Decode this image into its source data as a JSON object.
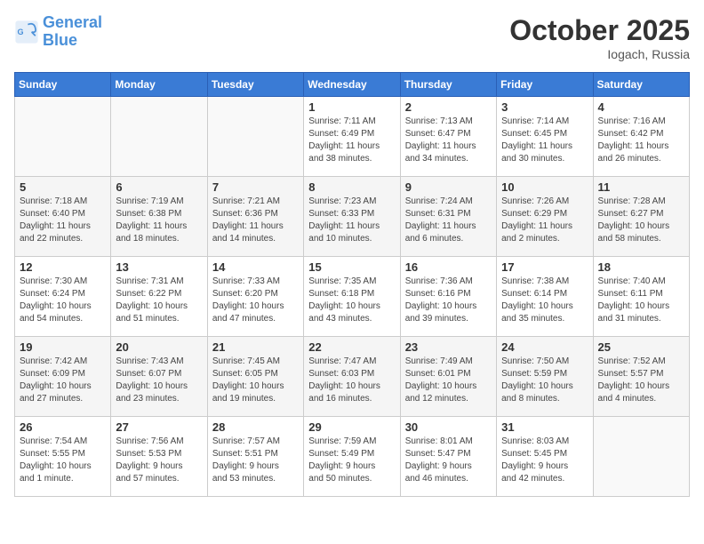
{
  "header": {
    "logo_line1": "General",
    "logo_line2": "Blue",
    "month": "October 2025",
    "location": "Iogach, Russia"
  },
  "days_of_week": [
    "Sunday",
    "Monday",
    "Tuesday",
    "Wednesday",
    "Thursday",
    "Friday",
    "Saturday"
  ],
  "weeks": [
    [
      {
        "day": "",
        "info": ""
      },
      {
        "day": "",
        "info": ""
      },
      {
        "day": "",
        "info": ""
      },
      {
        "day": "1",
        "info": "Sunrise: 7:11 AM\nSunset: 6:49 PM\nDaylight: 11 hours\nand 38 minutes."
      },
      {
        "day": "2",
        "info": "Sunrise: 7:13 AM\nSunset: 6:47 PM\nDaylight: 11 hours\nand 34 minutes."
      },
      {
        "day": "3",
        "info": "Sunrise: 7:14 AM\nSunset: 6:45 PM\nDaylight: 11 hours\nand 30 minutes."
      },
      {
        "day": "4",
        "info": "Sunrise: 7:16 AM\nSunset: 6:42 PM\nDaylight: 11 hours\nand 26 minutes."
      }
    ],
    [
      {
        "day": "5",
        "info": "Sunrise: 7:18 AM\nSunset: 6:40 PM\nDaylight: 11 hours\nand 22 minutes."
      },
      {
        "day": "6",
        "info": "Sunrise: 7:19 AM\nSunset: 6:38 PM\nDaylight: 11 hours\nand 18 minutes."
      },
      {
        "day": "7",
        "info": "Sunrise: 7:21 AM\nSunset: 6:36 PM\nDaylight: 11 hours\nand 14 minutes."
      },
      {
        "day": "8",
        "info": "Sunrise: 7:23 AM\nSunset: 6:33 PM\nDaylight: 11 hours\nand 10 minutes."
      },
      {
        "day": "9",
        "info": "Sunrise: 7:24 AM\nSunset: 6:31 PM\nDaylight: 11 hours\nand 6 minutes."
      },
      {
        "day": "10",
        "info": "Sunrise: 7:26 AM\nSunset: 6:29 PM\nDaylight: 11 hours\nand 2 minutes."
      },
      {
        "day": "11",
        "info": "Sunrise: 7:28 AM\nSunset: 6:27 PM\nDaylight: 10 hours\nand 58 minutes."
      }
    ],
    [
      {
        "day": "12",
        "info": "Sunrise: 7:30 AM\nSunset: 6:24 PM\nDaylight: 10 hours\nand 54 minutes."
      },
      {
        "day": "13",
        "info": "Sunrise: 7:31 AM\nSunset: 6:22 PM\nDaylight: 10 hours\nand 51 minutes."
      },
      {
        "day": "14",
        "info": "Sunrise: 7:33 AM\nSunset: 6:20 PM\nDaylight: 10 hours\nand 47 minutes."
      },
      {
        "day": "15",
        "info": "Sunrise: 7:35 AM\nSunset: 6:18 PM\nDaylight: 10 hours\nand 43 minutes."
      },
      {
        "day": "16",
        "info": "Sunrise: 7:36 AM\nSunset: 6:16 PM\nDaylight: 10 hours\nand 39 minutes."
      },
      {
        "day": "17",
        "info": "Sunrise: 7:38 AM\nSunset: 6:14 PM\nDaylight: 10 hours\nand 35 minutes."
      },
      {
        "day": "18",
        "info": "Sunrise: 7:40 AM\nSunset: 6:11 PM\nDaylight: 10 hours\nand 31 minutes."
      }
    ],
    [
      {
        "day": "19",
        "info": "Sunrise: 7:42 AM\nSunset: 6:09 PM\nDaylight: 10 hours\nand 27 minutes."
      },
      {
        "day": "20",
        "info": "Sunrise: 7:43 AM\nSunset: 6:07 PM\nDaylight: 10 hours\nand 23 minutes."
      },
      {
        "day": "21",
        "info": "Sunrise: 7:45 AM\nSunset: 6:05 PM\nDaylight: 10 hours\nand 19 minutes."
      },
      {
        "day": "22",
        "info": "Sunrise: 7:47 AM\nSunset: 6:03 PM\nDaylight: 10 hours\nand 16 minutes."
      },
      {
        "day": "23",
        "info": "Sunrise: 7:49 AM\nSunset: 6:01 PM\nDaylight: 10 hours\nand 12 minutes."
      },
      {
        "day": "24",
        "info": "Sunrise: 7:50 AM\nSunset: 5:59 PM\nDaylight: 10 hours\nand 8 minutes."
      },
      {
        "day": "25",
        "info": "Sunrise: 7:52 AM\nSunset: 5:57 PM\nDaylight: 10 hours\nand 4 minutes."
      }
    ],
    [
      {
        "day": "26",
        "info": "Sunrise: 7:54 AM\nSunset: 5:55 PM\nDaylight: 10 hours\nand 1 minute."
      },
      {
        "day": "27",
        "info": "Sunrise: 7:56 AM\nSunset: 5:53 PM\nDaylight: 9 hours\nand 57 minutes."
      },
      {
        "day": "28",
        "info": "Sunrise: 7:57 AM\nSunset: 5:51 PM\nDaylight: 9 hours\nand 53 minutes."
      },
      {
        "day": "29",
        "info": "Sunrise: 7:59 AM\nSunset: 5:49 PM\nDaylight: 9 hours\nand 50 minutes."
      },
      {
        "day": "30",
        "info": "Sunrise: 8:01 AM\nSunset: 5:47 PM\nDaylight: 9 hours\nand 46 minutes."
      },
      {
        "day": "31",
        "info": "Sunrise: 8:03 AM\nSunset: 5:45 PM\nDaylight: 9 hours\nand 42 minutes."
      },
      {
        "day": "",
        "info": ""
      }
    ]
  ]
}
